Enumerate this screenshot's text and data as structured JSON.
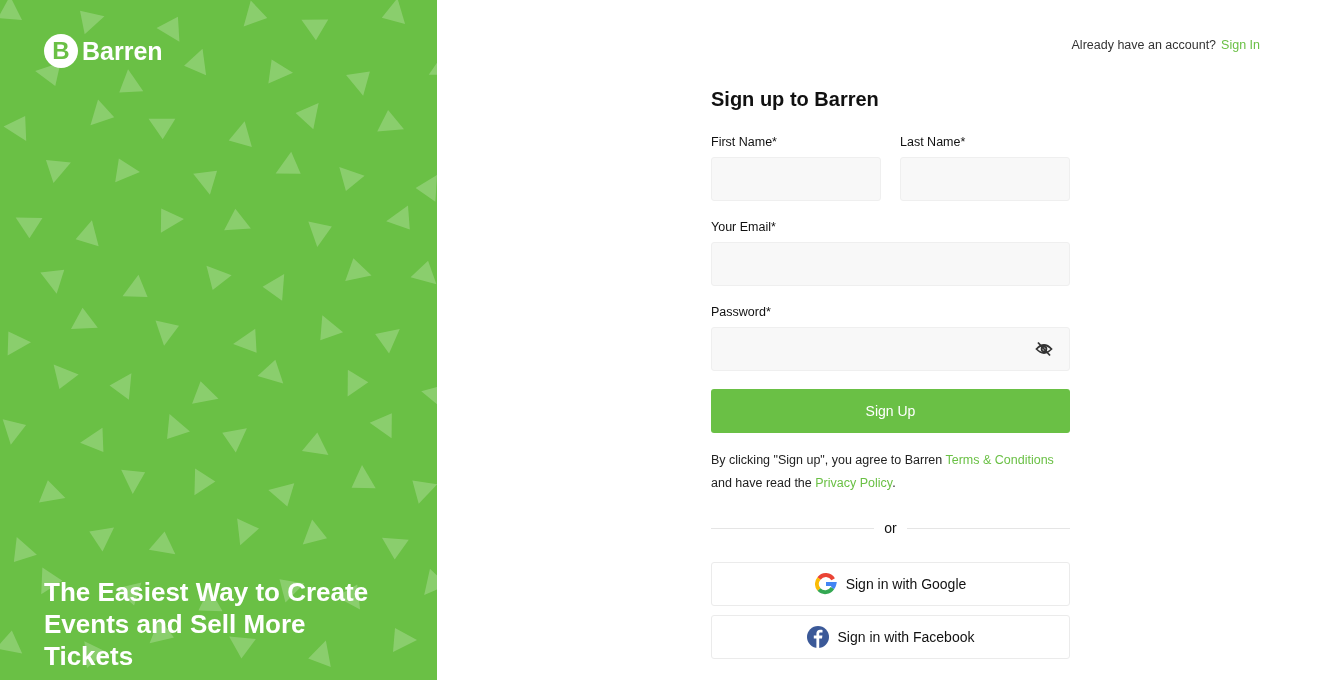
{
  "brand": {
    "mark": "B",
    "name": "Barren"
  },
  "tagline": "The Easiest Way to Create Events and Sell More Tickets",
  "top_bar": {
    "prompt": "Already have an account?",
    "link": "Sign In"
  },
  "form": {
    "title": "Sign up to Barren",
    "fields": [
      {
        "label": "First Name*",
        "kind": "text"
      },
      {
        "label": "Last Name*",
        "kind": "text"
      },
      {
        "label": "Your Email*",
        "kind": "email"
      },
      {
        "label": "Password*",
        "kind": "password"
      }
    ],
    "submit": "Sign Up",
    "agreement": [
      {
        "kind": "plain",
        "text": "By clicking \"Sign up\", you agree to Barren "
      },
      {
        "kind": "link",
        "text": "Terms & Conditions"
      },
      {
        "kind": "plain",
        "text": " and have read the "
      },
      {
        "kind": "link",
        "text": "Privacy Policy"
      },
      {
        "kind": "plain",
        "text": "."
      }
    ],
    "divider": "or",
    "social": [
      {
        "kind": "google",
        "label": "Sign in with Google"
      },
      {
        "kind": "facebook",
        "label": "Sign in with Facebook"
      }
    ]
  }
}
